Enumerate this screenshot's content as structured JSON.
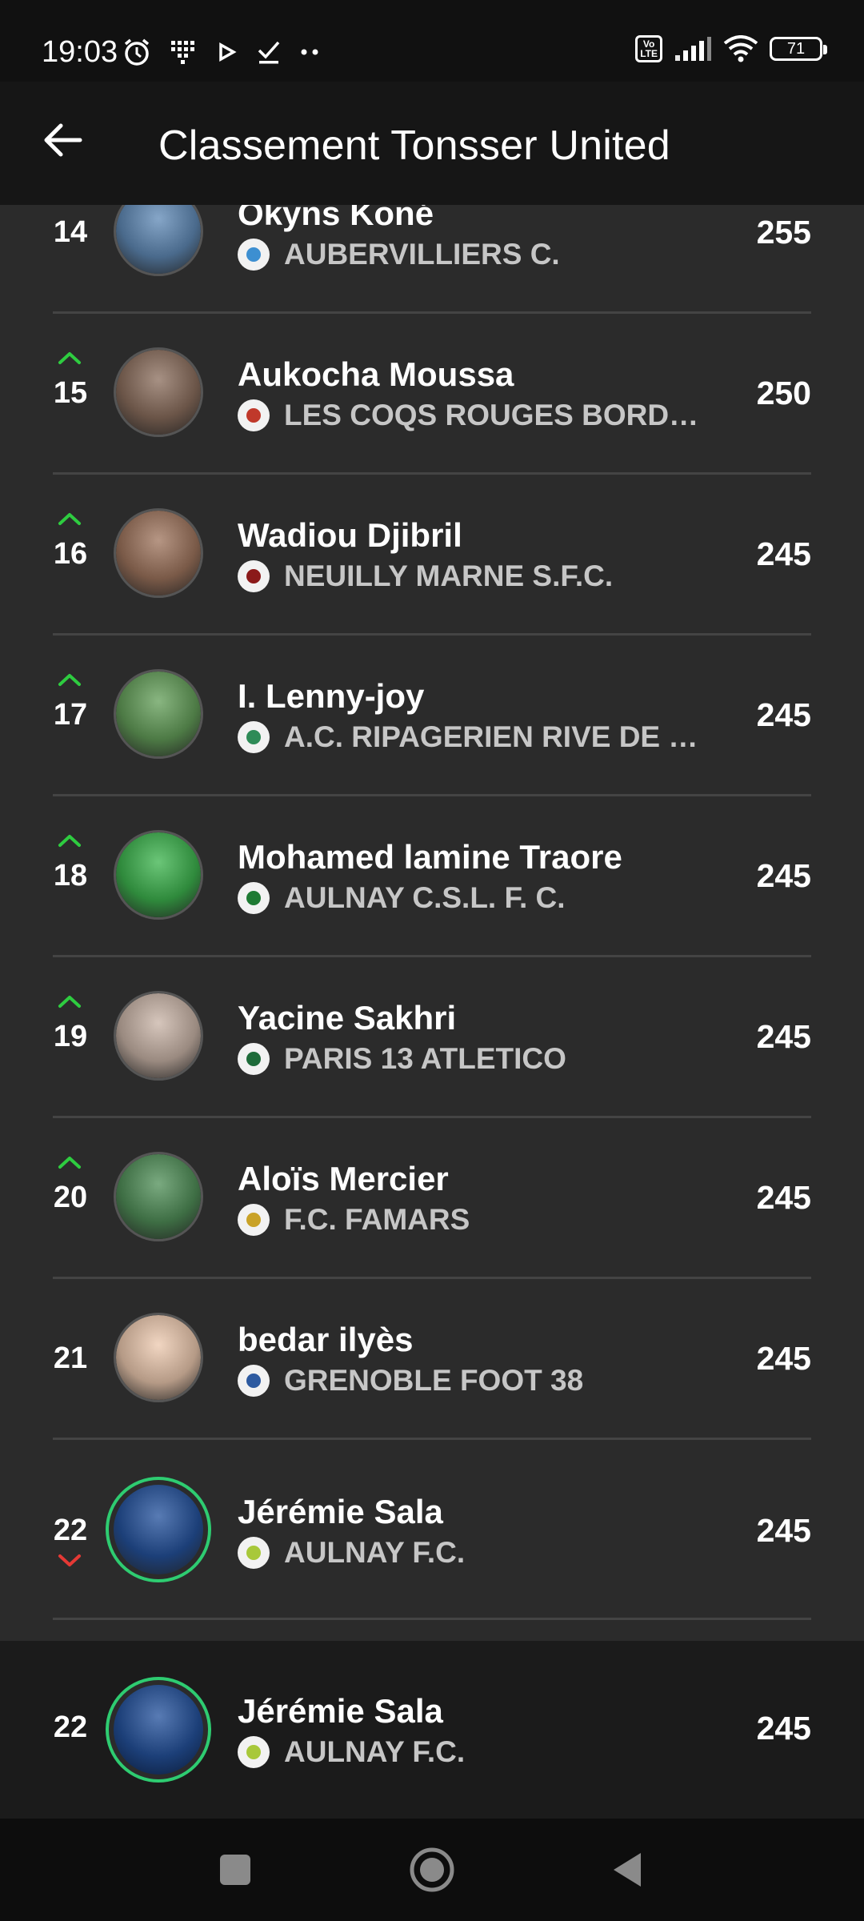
{
  "status_bar": {
    "time": "19:03",
    "volte_label": "Vo\nLTE",
    "battery": "71",
    "icons": [
      "alarm-icon",
      "grid-icon",
      "play-icon",
      "check-icon",
      "more-dots-icon",
      "volte-icon",
      "signal-icon",
      "wifi-icon",
      "battery-icon"
    ]
  },
  "header": {
    "back_icon": "arrow-left-icon",
    "title": "Classement Tonsser United"
  },
  "ranking": [
    {
      "rank": "14",
      "trend": "up",
      "name": "Okyns Koné",
      "club": "AUBERVILLIERS C.",
      "points": "255",
      "avatar_color": "#4a6a8c",
      "club_color": "#3d8fd1"
    },
    {
      "rank": "15",
      "trend": "up",
      "name": "Aukocha Moussa",
      "club": "LES COQS ROUGES BORDEA...",
      "points": "250",
      "avatar_color": "#6b5548",
      "club_color": "#c0392b"
    },
    {
      "rank": "16",
      "trend": "up",
      "name": "Wadiou Djibril",
      "club": "NEUILLY MARNE S.F.C.",
      "points": "245",
      "avatar_color": "#7a5a48",
      "club_color": "#8b1a1a"
    },
    {
      "rank": "17",
      "trend": "up",
      "name": "I. Lenny-joy",
      "club": "A.C. RIPAGERIEN RIVE DE GI...",
      "points": "245",
      "avatar_color": "#4d7a45",
      "club_color": "#2e8b57"
    },
    {
      "rank": "18",
      "trend": "up",
      "name": "Mohamed lamine Traore",
      "club": "AULNAY C.S.L. F. C.",
      "points": "245",
      "avatar_color": "#2f8a3c",
      "club_color": "#1e7a33"
    },
    {
      "rank": "19",
      "trend": "up",
      "name": "Yacine Sakhri",
      "club": "PARIS 13 ATLETICO",
      "points": "245",
      "avatar_color": "#9a8a80",
      "club_color": "#1e6b3a"
    },
    {
      "rank": "20",
      "trend": "up",
      "name": "Aloïs Mercier",
      "club": "F.C. FAMARS",
      "points": "245",
      "avatar_color": "#3e6e44",
      "club_color": "#c9a227"
    },
    {
      "rank": "21",
      "trend": "none",
      "name": "bedar ilyès",
      "club": "GRENOBLE FOOT 38",
      "points": "245",
      "avatar_color": "#b59a86",
      "club_color": "#2d5aa0"
    },
    {
      "rank": "22",
      "trend": "down",
      "name": "Jérémie Sala",
      "club": "AULNAY F.C.",
      "points": "245",
      "avatar_color": "#1c3f78",
      "club_color": "#a8c83a",
      "highlight": true
    }
  ],
  "current_user": {
    "rank": "22",
    "name": "Jérémie Sala",
    "club": "AULNAY F.C.",
    "points": "245",
    "avatar_color": "#1c3f78",
    "club_color": "#a8c83a"
  },
  "colors": {
    "trend_up": "#2ecc40",
    "trend_down": "#e53935",
    "highlight_ring": "#2ecc71"
  },
  "nav_bar": {
    "icons": [
      "square-icon",
      "circle-home-icon",
      "triangle-back-icon"
    ]
  }
}
